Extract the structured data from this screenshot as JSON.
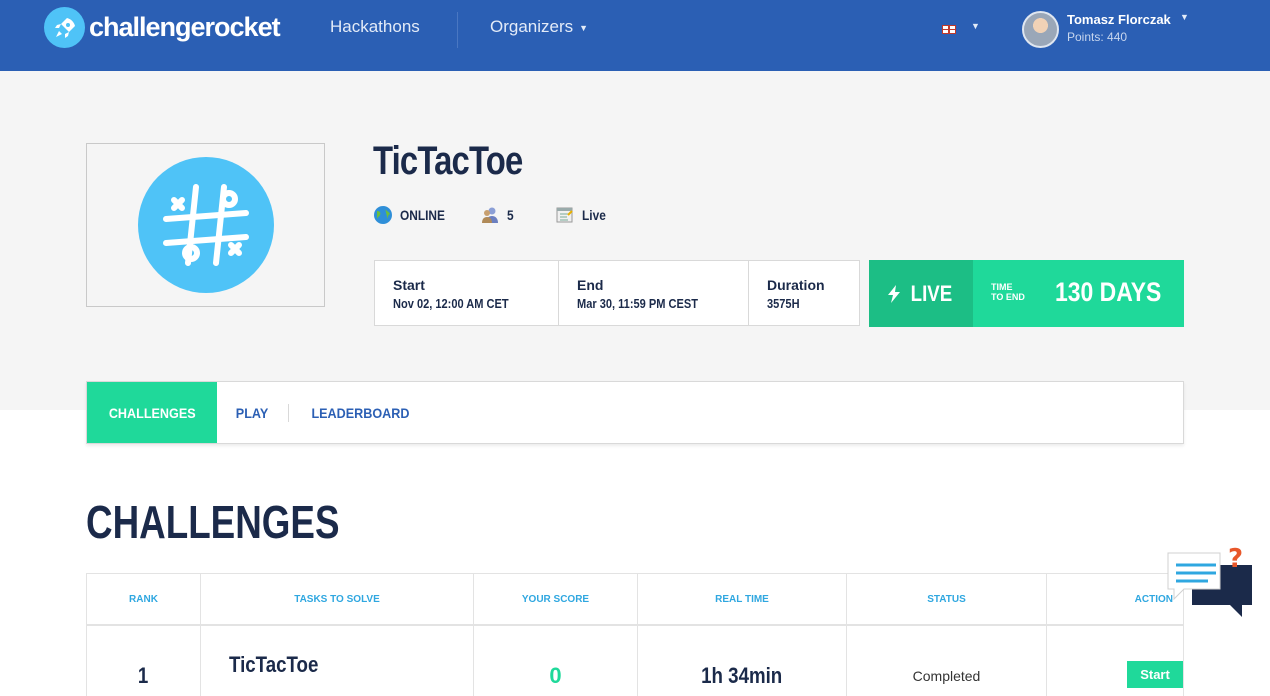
{
  "header": {
    "logo_text": "challengerocket",
    "nav": [
      {
        "label": "Hackathons"
      },
      {
        "label": "Organizers"
      }
    ],
    "user": {
      "name": "Tomasz Florczak",
      "points": "Points: 440"
    }
  },
  "event": {
    "title": "TicTacToe",
    "mode": "ONLINE",
    "participants": "5",
    "status": "Live",
    "start_label": "Start",
    "start_value": "Nov 02, 12:00 AM CET",
    "end_label": "End",
    "end_value": "Mar 30, 11:59 PM CEST",
    "duration_label": "Duration",
    "duration_value": "3575H",
    "live_label": "LIVE",
    "time_to_end_1": "TIME",
    "time_to_end_2": "TO END",
    "days_left": "130 DAYS"
  },
  "tabs": [
    {
      "label": "CHALLENGES",
      "active": true
    },
    {
      "label": "PLAY",
      "active": false
    },
    {
      "label": "LEADERBOARD",
      "active": false
    }
  ],
  "section_title": "CHALLENGES",
  "table": {
    "headers": [
      "RANK",
      "TASKS TO SOLVE",
      "YOUR SCORE",
      "REAL TIME",
      "STATUS",
      "ACTION"
    ],
    "rows": [
      {
        "rank": "1",
        "task": "TicTacToe",
        "score": "0",
        "real_time": "1h 34min",
        "status": "Completed",
        "action": "Start"
      }
    ]
  },
  "colors": {
    "brand_blue": "#2b5fb4",
    "accent_green": "#1fd99a",
    "header_text_blue": "#2fa7e0"
  }
}
